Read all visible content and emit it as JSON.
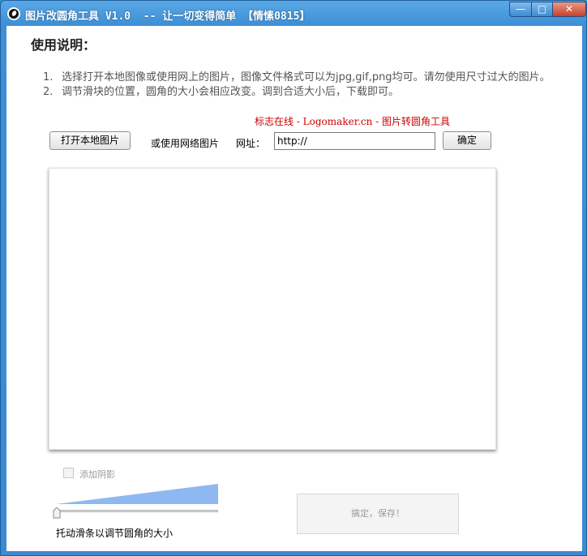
{
  "window": {
    "title": "图片改圆角工具 V1.0  -- 让一切变得简单 【情愫0815】"
  },
  "controls": {
    "minimize": "—",
    "maximize": "□",
    "close": "✕"
  },
  "instructions": {
    "heading": "使用说明：",
    "items": [
      {
        "num": "1.",
        "text": "选择打开本地图像或使用网上的图片，图像文件格式可以为jpg,gif,png均可。请勿使用尺寸过大的图片。"
      },
      {
        "num": "2.",
        "text": "调节滑块的位置，圆角的大小会相应改变。调到合适大小后，下载即可。"
      }
    ]
  },
  "brand_text": "标志在线 - Logomaker.cn - 图片转圆角工具",
  "toolbar": {
    "open_local_label": "打开本地图片",
    "or_web_label": "或使用网络图片",
    "url_label": "网址：",
    "url_value": "http://",
    "confirm_label": "确定"
  },
  "options": {
    "add_shadow_label": "添加阴影",
    "add_shadow_checked": false,
    "slider_hint": "托动滑条以调节圆角的大小",
    "slider_value": 0
  },
  "save_button_label": "搞定，保存！",
  "colors": {
    "brand_red": "#cc0000",
    "slider_fill": "#8fb8f0",
    "title_bar": "#3d8fd6"
  }
}
